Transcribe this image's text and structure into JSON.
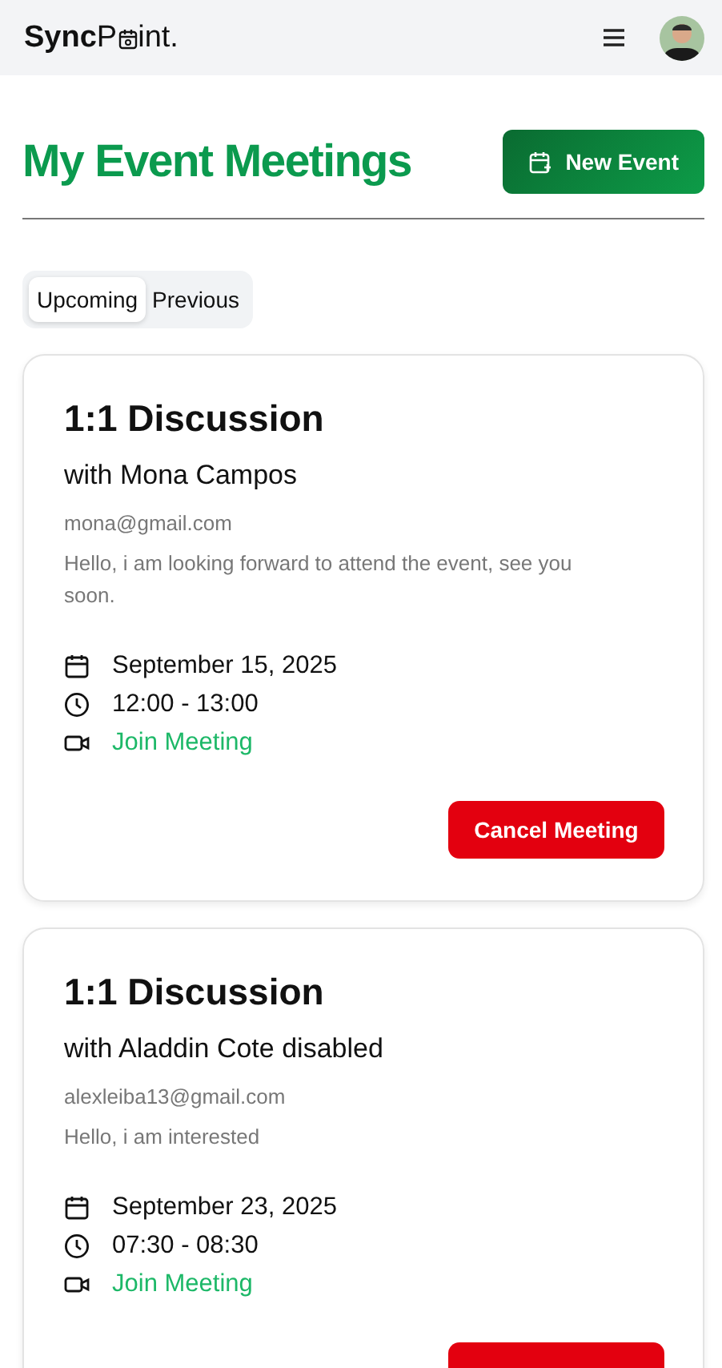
{
  "header": {
    "logo": {
      "bold": "Sync",
      "before_icon": "P",
      "after_icon": "int."
    }
  },
  "page": {
    "title": "My Event Meetings",
    "new_button": "New Event"
  },
  "tabs": [
    {
      "label": "Upcoming",
      "selected": true
    },
    {
      "label": "Previous",
      "selected": false
    }
  ],
  "meetings": [
    {
      "title": "1:1 Discussion",
      "with": "with Mona Campos",
      "email": "mona@gmail.com",
      "message": "Hello, i am looking forward to attend the event, see you soon.",
      "date": "September 15, 2025",
      "time": "12:00 - 13:00",
      "link": "Join Meeting",
      "actions": [
        {
          "kind": "cancel",
          "label": "Cancel Meeting"
        }
      ]
    },
    {
      "title": "1:1 Discussion",
      "with": "with Aladdin Cote disabled",
      "email": "alexleiba13@gmail.com",
      "message": "Hello, i am interested",
      "date": "September 23, 2025",
      "time": "07:30 - 08:30",
      "link": "Join Meeting",
      "actions": [
        {
          "kind": "cancel"
        }
      ]
    }
  ]
}
